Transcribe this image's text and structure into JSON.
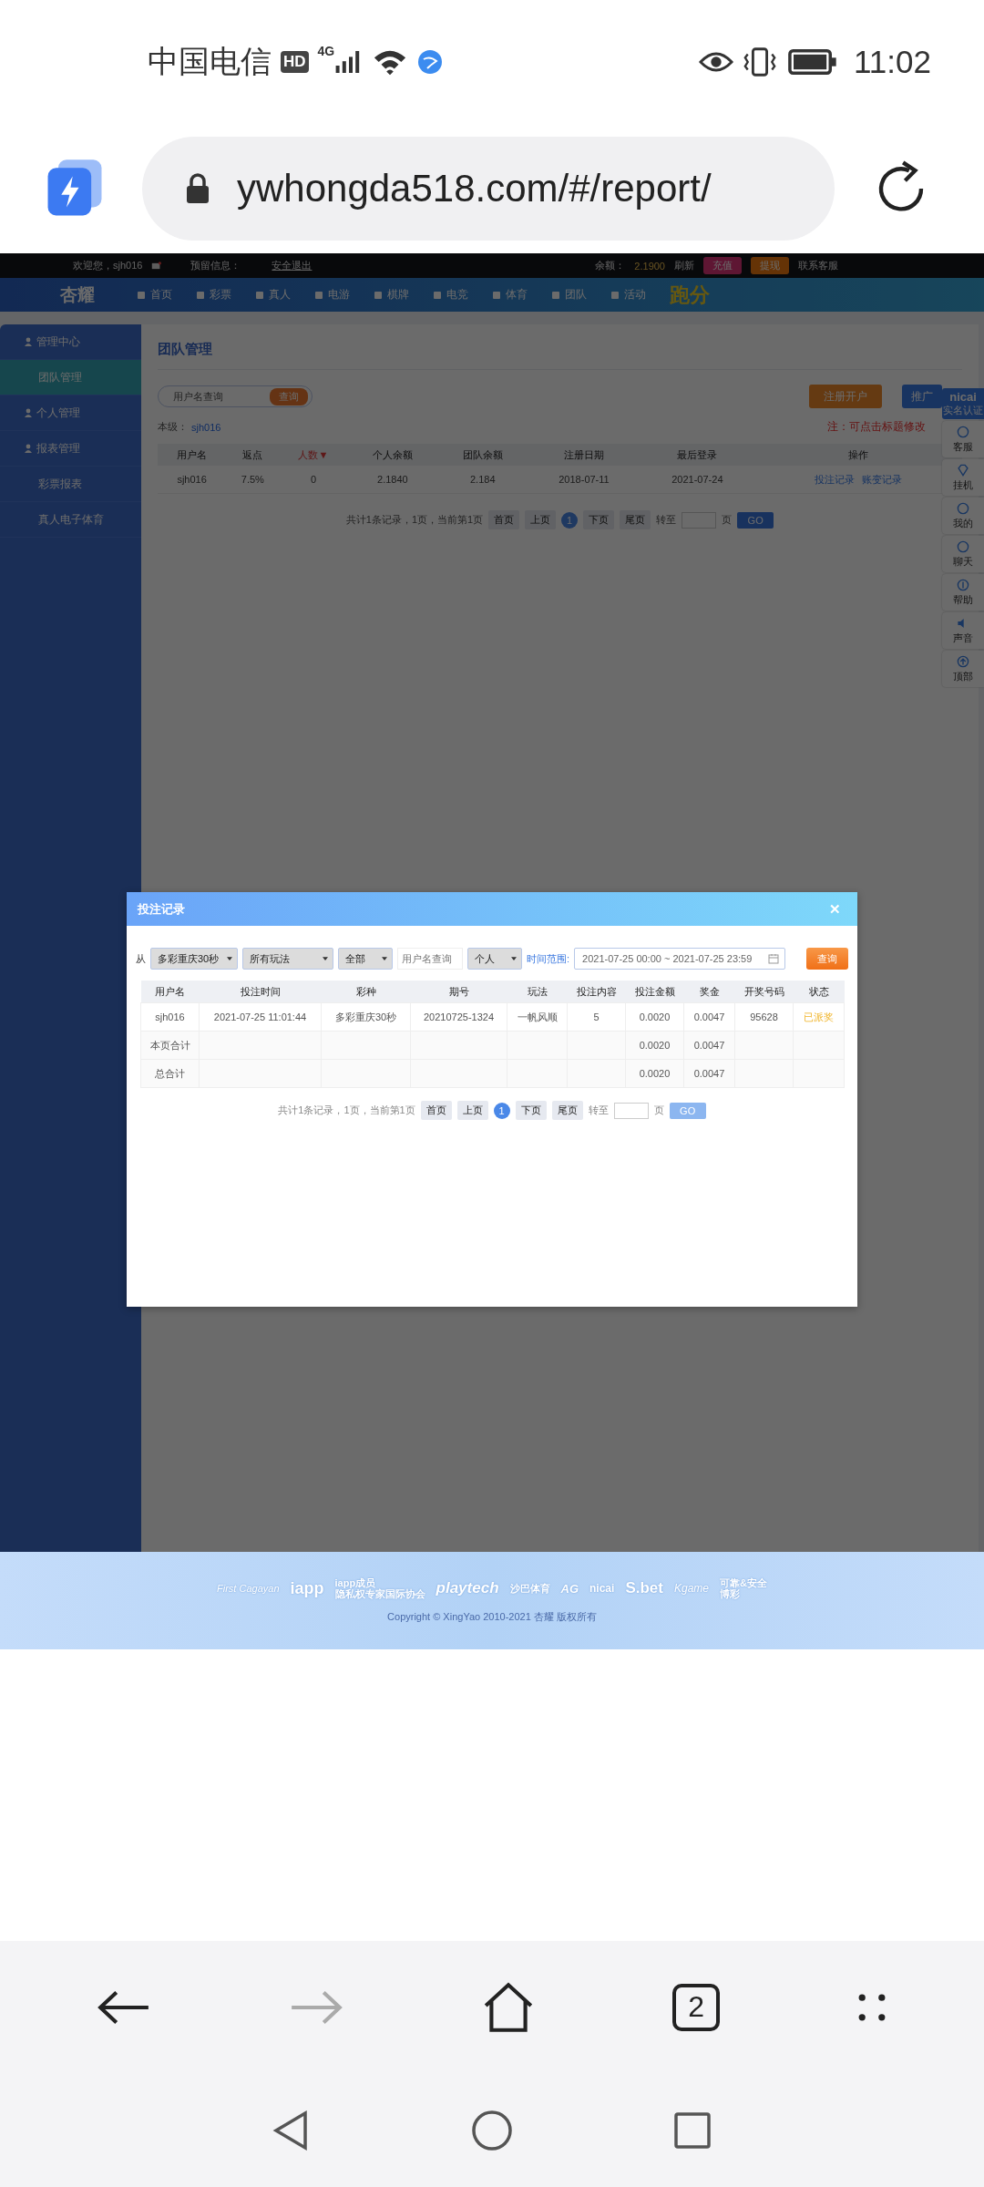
{
  "status_bar": {
    "carrier": "中国电信",
    "hd": "HD",
    "network": "4G",
    "time": "11:02"
  },
  "browser": {
    "url": "ywhongda518.com/#/report/",
    "tab_count": "2",
    "nav_buttons": [
      {
        "kind": "back",
        "disabled": false
      },
      {
        "kind": "forward",
        "disabled": true
      },
      {
        "kind": "home",
        "disabled": false
      }
    ]
  },
  "site": {
    "topbar": {
      "welcome": "欢迎您，sjh016",
      "reserved": "预留信息：",
      "logout": "安全退出",
      "balance_label": "余额：",
      "balance": "2.1900",
      "refresh": "刷新",
      "deposit": "充值",
      "withdraw": "提现",
      "support": "联系客服"
    },
    "logo": "杏耀",
    "nav": [
      {
        "label": "首页"
      },
      {
        "label": "彩票"
      },
      {
        "label": "真人"
      },
      {
        "label": "电游"
      },
      {
        "label": "棋牌"
      },
      {
        "label": "电竞"
      },
      {
        "label": "体育"
      },
      {
        "label": "团队"
      },
      {
        "label": "活动"
      }
    ],
    "promo": "跑分",
    "sidebar": [
      {
        "label": "管理中心",
        "kind": "section",
        "selected": false
      },
      {
        "label": "团队管理",
        "kind": "link",
        "selected": true
      },
      {
        "label": "个人管理",
        "kind": "section",
        "selected": false
      },
      {
        "label": "报表管理",
        "kind": "section",
        "selected": false
      },
      {
        "label": "彩票报表",
        "kind": "link",
        "selected": false
      },
      {
        "label": "真人电子体育",
        "kind": "link",
        "selected": false
      }
    ],
    "page_title": "团队管理",
    "search": {
      "placeholder": "用户名查询",
      "button": "查询"
    },
    "actions": [
      {
        "label": "注册开户",
        "kind": "register"
      },
      {
        "label": "推广",
        "kind": "share"
      }
    ],
    "level_label": "本级：",
    "level_user": "sjh016",
    "note": "注：可点击标题修改",
    "table": {
      "columns": [
        {
          "label": "用户名",
          "sorted": false
        },
        {
          "label": "返点",
          "sorted": false
        },
        {
          "label": "人数▼",
          "sorted": true
        },
        {
          "label": "个人余额",
          "sorted": false
        },
        {
          "label": "团队余额",
          "sorted": false
        },
        {
          "label": "注册日期",
          "sorted": false
        },
        {
          "label": "最后登录",
          "sorted": false
        },
        {
          "label": "操作",
          "sorted": false
        }
      ],
      "rows": [
        {
          "cells": [
            "sjh016",
            "7.5%",
            "0",
            "2.1840",
            "2.184",
            "2018-07-11",
            "2021-07-24"
          ],
          "links": [
            "投注记录",
            "账变记录"
          ]
        }
      ]
    },
    "pagination": {
      "summary": "共计1条记录，1页，当前第1页",
      "prev": [
        "首页",
        "上页"
      ],
      "pages": [
        {
          "label": "1",
          "selected": true
        }
      ],
      "next": [
        "下页",
        "尾页"
      ],
      "goto": "转至",
      "unit": "页",
      "go": "GO"
    },
    "side_tools": {
      "badge": "nicai",
      "badge_sub": "实名认证",
      "items": [
        {
          "label": "客服"
        },
        {
          "label": "挂机"
        },
        {
          "label": "我的"
        },
        {
          "label": "聊天"
        },
        {
          "label": "帮助"
        },
        {
          "label": "声音"
        },
        {
          "label": "顶部"
        }
      ]
    }
  },
  "modal": {
    "title": "投注记录",
    "close": "✕",
    "from": "从",
    "selects": [
      {
        "value": "多彩重庆30秒"
      },
      {
        "value": "所有玩法"
      },
      {
        "value": "全部"
      }
    ],
    "user_placeholder": "用户名查询",
    "scope": "个人",
    "range_label": "时间范围:",
    "range": "2021-07-25 00:00 ~ 2021-07-25 23:59",
    "query": "查询",
    "columns": [
      "用户名",
      "投注时间",
      "彩种",
      "期号",
      "玩法",
      "投注内容",
      "投注金额",
      "奖金",
      "开奖号码",
      "状态"
    ],
    "rows": [
      {
        "kind": "bet",
        "cells": [
          "sjh016",
          "2021-07-25 11:01:44",
          "多彩重庆30秒",
          "20210725-1324",
          "一帆风顺",
          "5",
          "0.0020",
          "0.0047",
          "95628"
        ],
        "status": "已派奖"
      },
      {
        "kind": "total",
        "label": "本页合计",
        "amount": "0.0020",
        "prize": "0.0047"
      },
      {
        "kind": "total",
        "label": "总合计",
        "amount": "0.0020",
        "prize": "0.0047"
      }
    ],
    "pagination": {
      "summary": "共计1条记录，1页，当前第1页",
      "prev": [
        "首页",
        "上页"
      ],
      "pages": [
        {
          "label": "1",
          "selected": true
        }
      ],
      "next": [
        "下页",
        "尾页"
      ],
      "goto": "转至",
      "unit": "页",
      "go": "GO"
    }
  },
  "footer": {
    "logos": [
      {
        "lines": [
          "First Cagayan"
        ]
      },
      {
        "lines": [
          "iapp"
        ]
      },
      {
        "lines": [
          "iapp成员",
          "隐私权专家国际协会"
        ]
      },
      {
        "lines": [
          "playtech"
        ]
      },
      {
        "lines": [
          "沙巴体育"
        ]
      },
      {
        "lines": [
          "AG"
        ]
      },
      {
        "lines": [
          "nicai"
        ]
      },
      {
        "lines": [
          "S.bet"
        ]
      },
      {
        "lines": [
          "Kgame"
        ]
      },
      {
        "lines": [
          "可靠&安全",
          "博彩"
        ]
      }
    ],
    "copyright": "Copyright © XingYao 2010-2021 杏耀 版权所有"
  }
}
